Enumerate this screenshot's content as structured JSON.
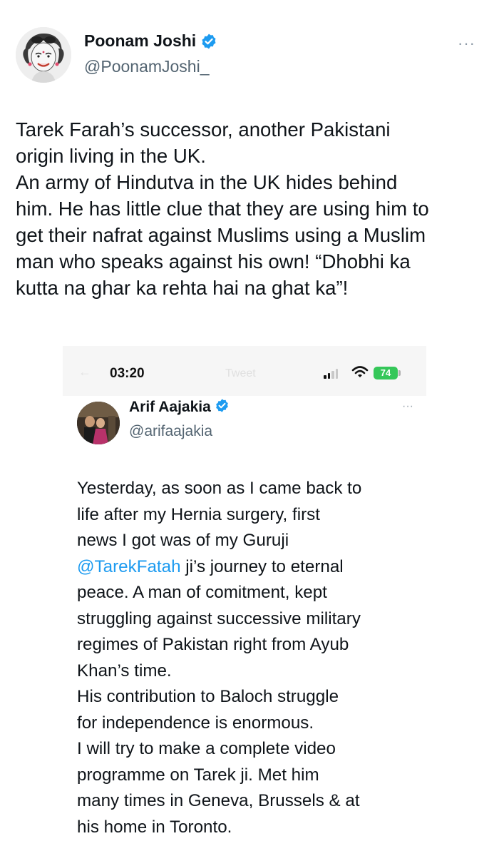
{
  "tweet": {
    "author": {
      "name": "Poonam Joshi",
      "handle": "@PoonamJoshi_"
    },
    "more_label": "···",
    "text": "Tarek Farah’s successor, another Pakistani\norigin living in the UK.\nAn army of Hindutva in the UK hides behind\nhim. He has little clue that they are using him to\nget their nafrat against Muslims using a Muslim\nman who speaks against his own! “Dhobhi ka\nkutta na ghar ka rehta hai na ghat ka”!"
  },
  "embedded_screenshot": {
    "status_bar": {
      "time": "03:20",
      "battery": "74",
      "faint_title": "Tweet",
      "faint_back": "←"
    },
    "author": {
      "name": "Arif Aajakia",
      "handle": "@arifaajakia"
    },
    "more_label": "···",
    "lines": {
      "l1": "Yesterday, as soon as I came back to",
      "l2": "life after my Hernia surgery, first",
      "l3": "news I got was of my Guruji",
      "l4_mention": "@TarekFatah",
      "l4_rest": " ji’s journey to eternal",
      "l5": "peace. A man of comitment, kept",
      "l6": "struggling against successive military",
      "l7": "regimes of Pakistan right from Ayub",
      "l8": "Khan’s time.",
      "l9": "His contribution to Baloch struggle",
      "l10": "for independence is enormous.",
      "l11": "I will try to make a complete video",
      "l12": "programme on Tarek ji. Met him",
      "l13": "many times in Geneva, Brussels & at",
      "l14": "his home in Toronto."
    }
  },
  "colors": {
    "verified": "#1d9bf0",
    "mention": "#1d9bf0",
    "battery": "#35c759",
    "text": "#0f1419",
    "secondary": "#536471"
  },
  "icons": [
    "verified-badge-icon",
    "more-options-icon",
    "signal-icon",
    "wifi-icon",
    "battery-icon",
    "back-arrow-icon"
  ]
}
